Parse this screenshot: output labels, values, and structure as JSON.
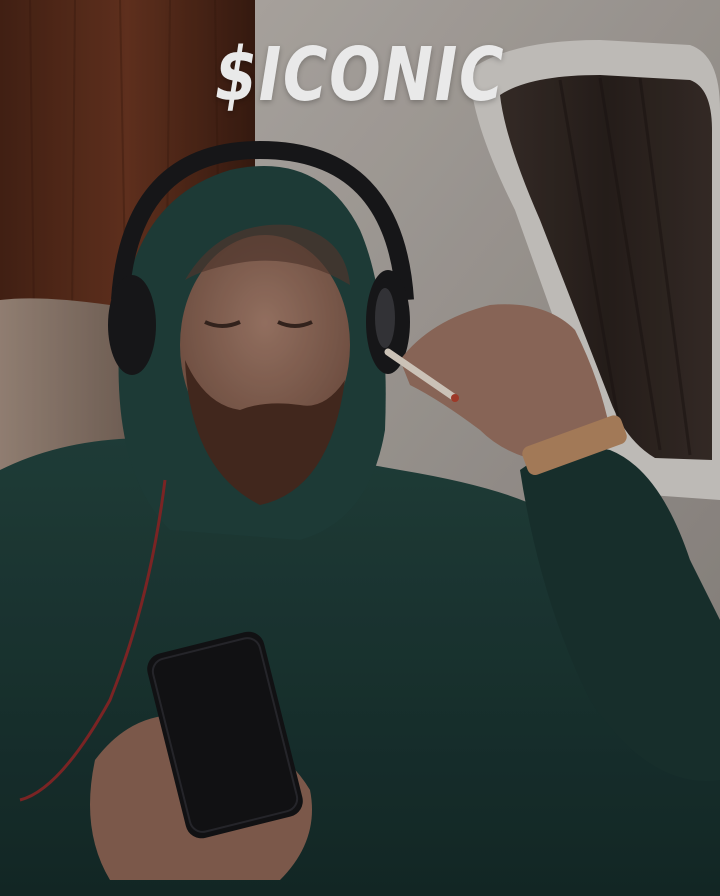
{
  "overlay": {
    "title": "$ICONIC",
    "title_color": "#e9e9e9"
  },
  "scene": {
    "palette": {
      "wood_panel": "#5a2e1d",
      "cabin_wall": "#b9b3ad",
      "window_frame": "#d7d3cf",
      "window_shade": "#2e2724",
      "seat_leather": "#9a877a",
      "hoodie": "#1d3b38",
      "skin": "#9a7262",
      "beard": "#4b3026",
      "headphones": "#1a1a1c",
      "phone": "#141416",
      "bracelet": "#b98a63",
      "cable": "#8b2a2a"
    }
  }
}
